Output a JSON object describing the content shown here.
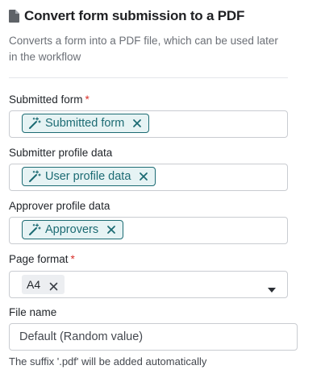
{
  "header": {
    "title": "Convert form submission to a PDF",
    "icon": "document-icon"
  },
  "description": "Converts a form into a PDF file, which can be used later in the workflow",
  "fields": [
    {
      "label": "Submitted form",
      "required": true,
      "chip": "Submitted form"
    },
    {
      "label": "Submitter profile data",
      "required": false,
      "chip": "User profile data"
    },
    {
      "label": "Approver profile data",
      "required": false,
      "chip": "Approvers"
    }
  ],
  "page_format": {
    "label": "Page format",
    "required": true,
    "value": "A4"
  },
  "file_name": {
    "label": "File name",
    "placeholder": "Default (Random value)",
    "hint": "The suffix '.pdf' will be added automatically"
  },
  "required_marker": "*",
  "colors": {
    "accent": "#1c6b73",
    "chip_bg": "#e6f3f4",
    "required": "#d9302a"
  }
}
